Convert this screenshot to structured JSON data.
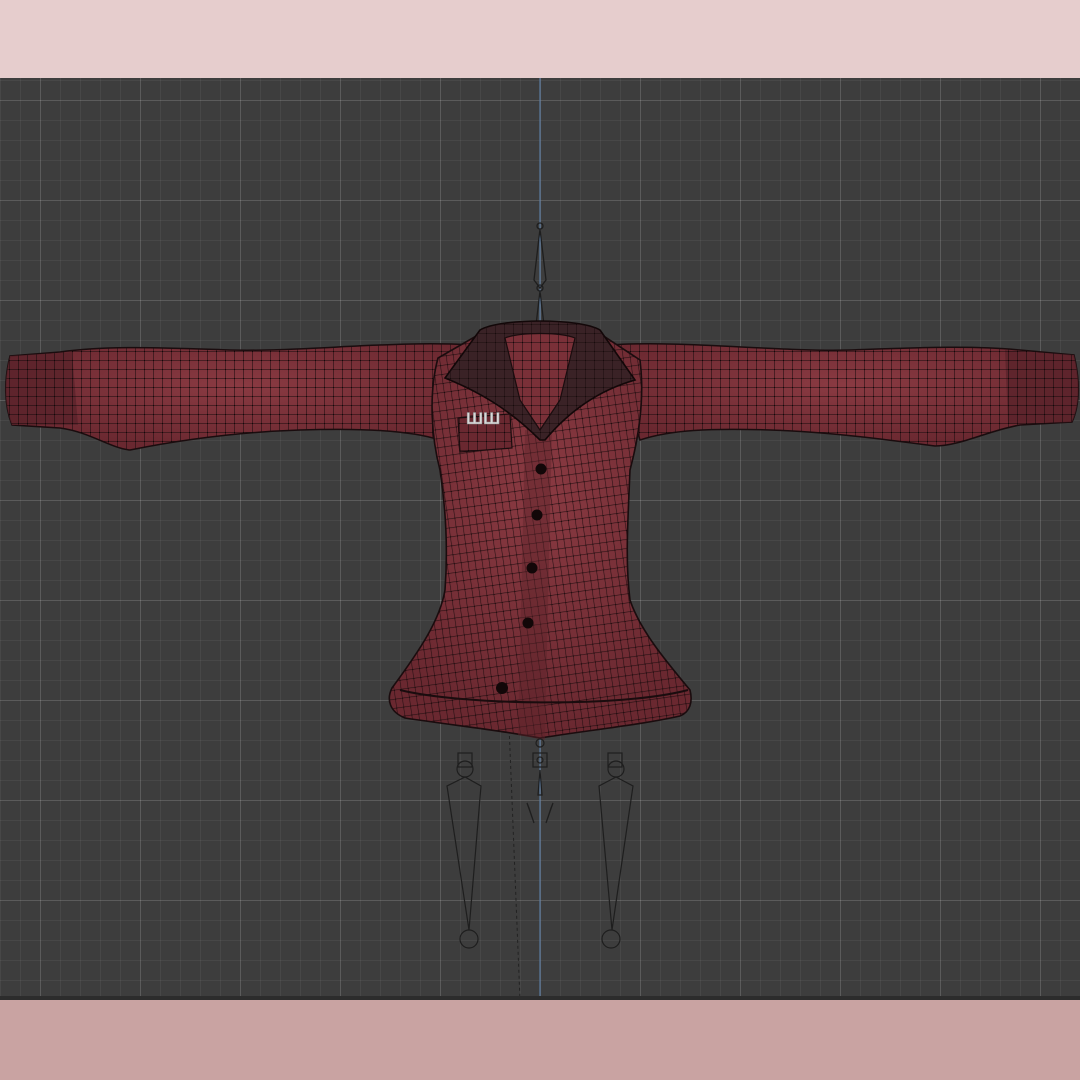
{
  "app": {
    "view": "3d-viewport",
    "shading": "wireframe-overlay"
  },
  "scene": {
    "object": "jacket-mesh",
    "pocket_text": "ШШ",
    "colors": {
      "background_top": "#e6cdcd",
      "background_bottom": "#c9a3a2",
      "viewport": "#3d3d3d",
      "cloth": "#7a3038",
      "cloth_dark": "#4a1c22",
      "collar": "#3a2226",
      "wire": "#1a0c0e",
      "axis": "#5a7aa0",
      "bones": "#1e1e1e"
    }
  }
}
